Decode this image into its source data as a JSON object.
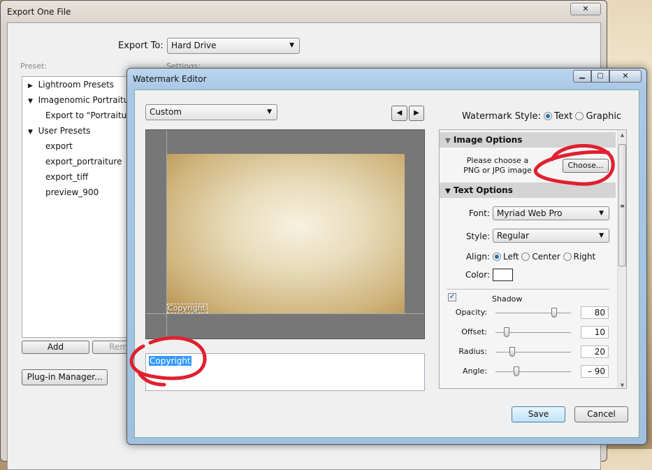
{
  "export_window": {
    "title": "Export One File",
    "export_to_label": "Export To:",
    "export_to_value": "Hard Drive",
    "preset_label": "Preset:",
    "settings_label": "Settings:",
    "presets": [
      {
        "label": "Lightroom Presets",
        "type": "collapsed"
      },
      {
        "label": "Imagenomic Portraitu",
        "type": "expanded"
      },
      {
        "label": "Export to \"Portraiture",
        "type": "child"
      },
      {
        "label": "User Presets",
        "type": "expanded"
      },
      {
        "label": "export",
        "type": "child"
      },
      {
        "label": "export_portraiture",
        "type": "child"
      },
      {
        "label": "export_tiff",
        "type": "child"
      },
      {
        "label": "preview_900",
        "type": "child"
      }
    ],
    "add_label": "Add",
    "remove_label": "Remove",
    "plugin_manager_label": "Plug-in Manager..."
  },
  "watermark_editor": {
    "title": "Watermark Editor",
    "preset_value": "Custom",
    "style_label": "Watermark Style:",
    "style_options": [
      "Text",
      "Graphic"
    ],
    "style_selected": "Text",
    "preview_watermark": "Copyright",
    "text_value": "Copyright",
    "image_options": {
      "header": "Image Options",
      "hint_line1": "Please choose a",
      "hint_line2": "PNG or JPG image",
      "choose_label": "Choose..."
    },
    "text_options": {
      "header": "Text Options",
      "font_label": "Font:",
      "font_value": "Myriad Web Pro",
      "style_label": "Style:",
      "style_value": "Regular",
      "align_label": "Align:",
      "align_options": [
        "Left",
        "Center",
        "Right"
      ],
      "align_selected": "Left",
      "color_label": "Color:",
      "color_value": "#ffffff"
    },
    "shadow": {
      "label": "Shadow",
      "checked": true,
      "opacity_label": "Opacity:",
      "opacity": 80,
      "offset_label": "Offset:",
      "offset": 10,
      "radius_label": "Radius:",
      "radius": 20,
      "angle_label": "Angle:",
      "angle": "– 90"
    },
    "save_label": "Save",
    "cancel_label": "Cancel"
  },
  "colors": {
    "annotation": "#e02030",
    "selection": "#3399ff"
  }
}
